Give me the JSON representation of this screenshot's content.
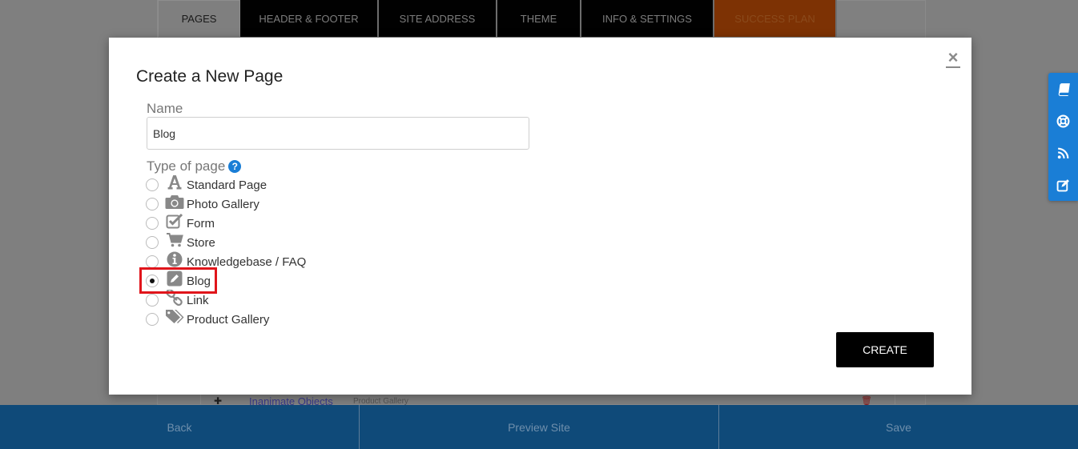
{
  "top_tabs": [
    {
      "label": "PAGES",
      "active": true
    },
    {
      "label": "HEADER & FOOTER"
    },
    {
      "label": "SITE ADDRESS"
    },
    {
      "label": "THEME"
    },
    {
      "label": "INFO & SETTINGS"
    },
    {
      "label": "SUCCESS PLAN",
      "accent": "#d65a0a"
    }
  ],
  "background_row": {
    "name": "Inanimate Objects",
    "type": "Product Gallery"
  },
  "side_toolbar": {
    "color": "#1a7ed6",
    "items": [
      "book-icon",
      "life-ring-icon",
      "rss-icon",
      "edit-icon"
    ]
  },
  "modal": {
    "title": "Create a New Page",
    "close_glyph": "×",
    "name_label": "Name",
    "name_value": "Blog",
    "type_label": "Type of page",
    "help_glyph": "?",
    "page_types": [
      {
        "label": "Standard Page",
        "icon": "font-icon"
      },
      {
        "label": "Photo Gallery",
        "icon": "camera-icon"
      },
      {
        "label": "Form",
        "icon": "checkbox-icon"
      },
      {
        "label": "Store",
        "icon": "cart-icon"
      },
      {
        "label": "Knowledgebase / FAQ",
        "icon": "info-icon"
      },
      {
        "label": "Blog",
        "icon": "pencil-square-icon",
        "selected": true
      },
      {
        "label": "Link",
        "icon": "link-icon"
      },
      {
        "label": "Product Gallery",
        "icon": "tags-icon"
      }
    ],
    "create_label": "CREATE",
    "highlight_color": "#e0151b"
  },
  "bottom_bar": {
    "back_label": "Back",
    "preview_label": "Preview Site",
    "save_label": "Save",
    "color": "#0f4a79"
  }
}
